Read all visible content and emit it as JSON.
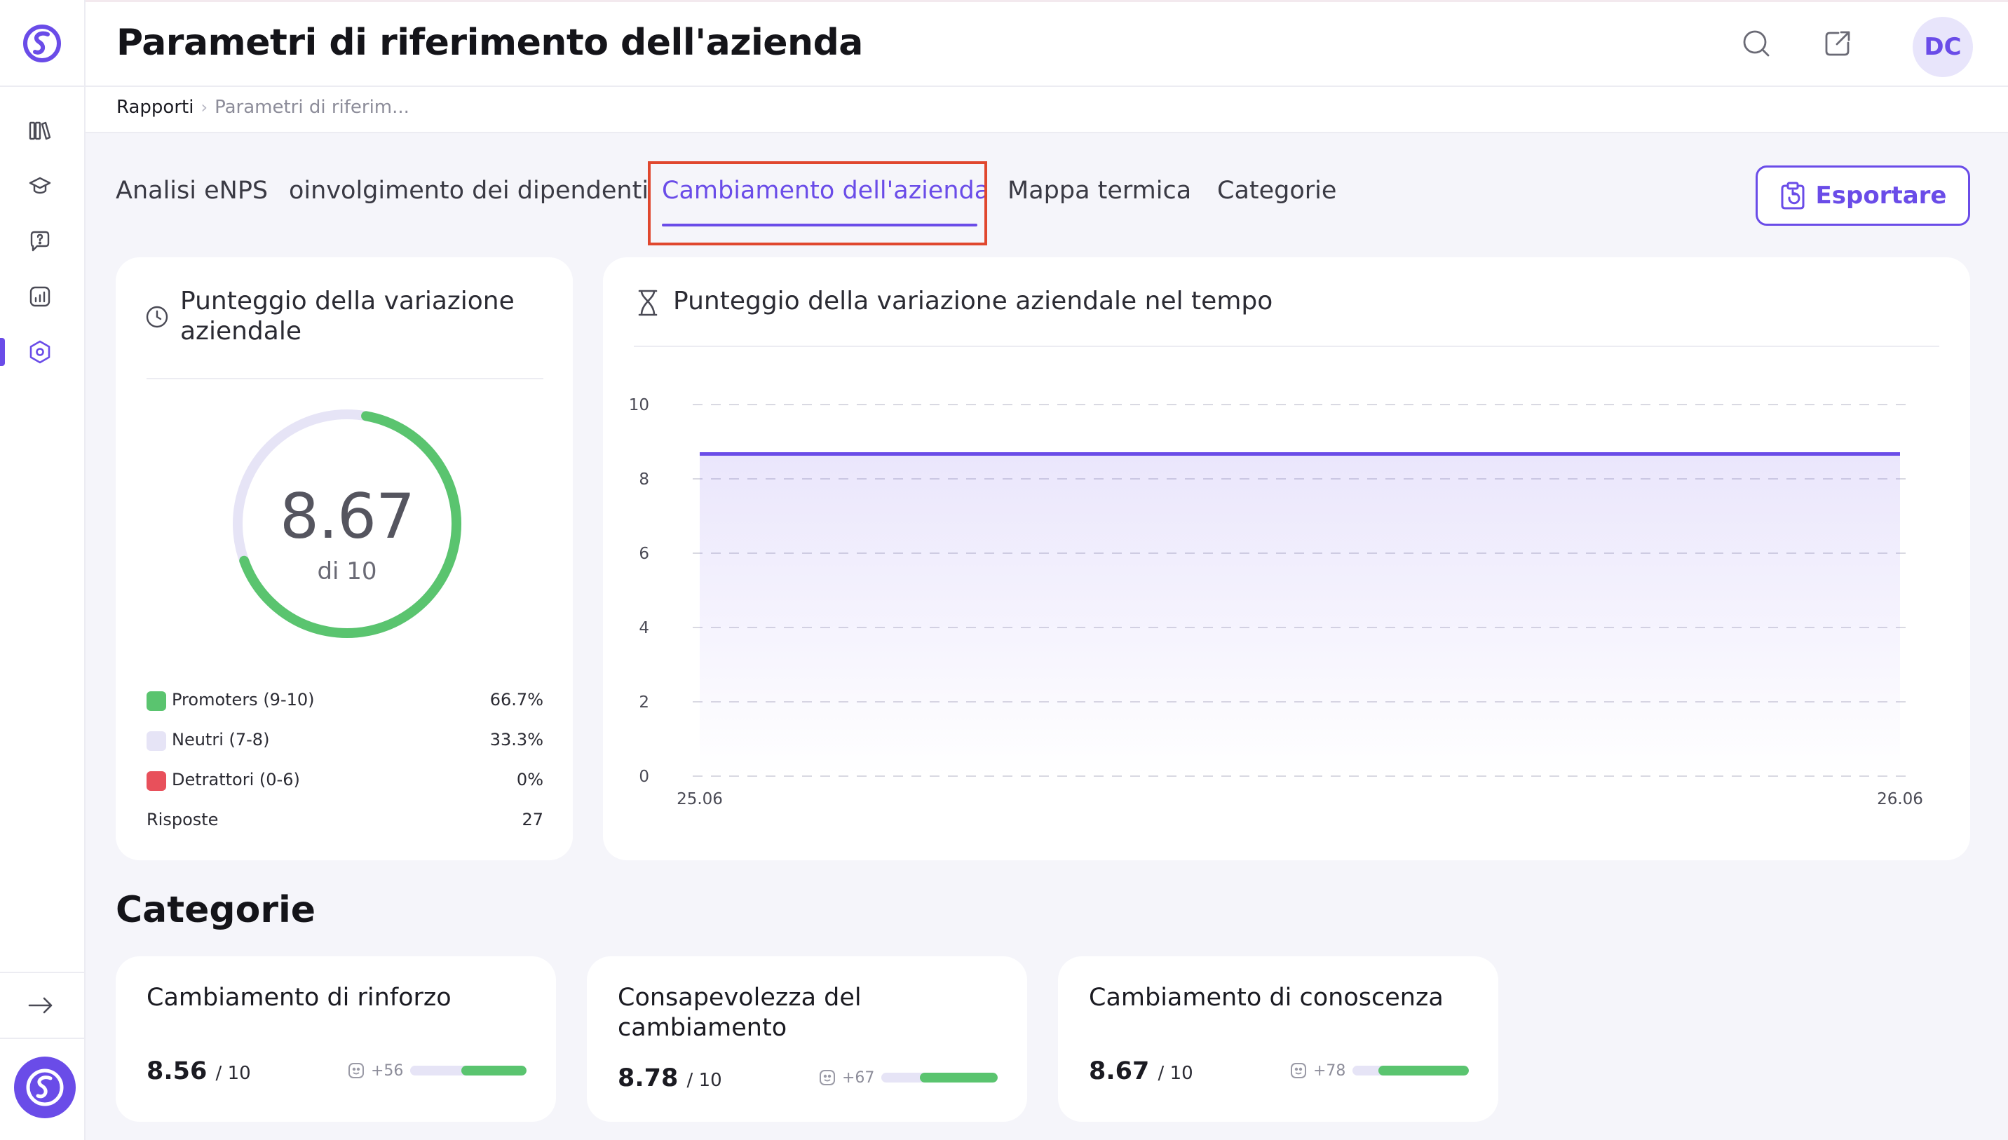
{
  "app": {
    "title": "Parametri di riferimento dell'azienda",
    "accent": "#6a4ce8"
  },
  "sidebar": {
    "items": [
      {
        "icon": "library-icon"
      },
      {
        "icon": "graduation-cap-icon"
      },
      {
        "icon": "help-chat-icon"
      },
      {
        "icon": "analytics-icon"
      },
      {
        "icon": "settings-hexagon-icon",
        "active": true
      }
    ],
    "expand_icon": "arrow-right-icon"
  },
  "header": {
    "avatar_initials": "DC"
  },
  "breadcrumb": {
    "root": "Rapporti",
    "current": "Parametri di riferim..."
  },
  "tabs": [
    {
      "label": "Analisi eNPS"
    },
    {
      "label": "oinvolgimento dei dipendenti"
    },
    {
      "label": "Cambiamento dell'azienda",
      "active": true
    },
    {
      "label": "Mappa termica"
    },
    {
      "label": "Categorie"
    }
  ],
  "export_button": {
    "label": "Esportare"
  },
  "score_card": {
    "title": "Punteggio della variazione aziendale",
    "value": "8.67",
    "of_label": "di 10",
    "gauge_fraction": 0.667,
    "legend": [
      {
        "label": "Promoters (9-10)",
        "value": "66.7%",
        "color": "#5ac46f"
      },
      {
        "label": "Neutri (7-8)",
        "value": "33.3%",
        "color": "#e6e4f6"
      },
      {
        "label": "Detrattori (0-6)",
        "value": "0%",
        "color": "#e8505b"
      },
      {
        "label": "Risposte",
        "value": "27"
      }
    ]
  },
  "chart_card": {
    "title": "Punteggio della variazione aziendale nel tempo"
  },
  "chart_data": {
    "type": "area",
    "x": [
      "25.06",
      "26.06"
    ],
    "series": [
      {
        "values": [
          8.67,
          8.67
        ],
        "color": "#6a4ce8"
      }
    ],
    "ylim": [
      0,
      10
    ],
    "yticks": [
      "0",
      "2",
      "4",
      "6",
      "8",
      "10"
    ],
    "grid": true,
    "title": "",
    "xlabel": "",
    "ylabel": ""
  },
  "categories_section": {
    "title": "Categorie",
    "cards": [
      {
        "title": "Cambiamento di rinforzo",
        "score": "8.56",
        "of": "/ 10",
        "delta": "+56",
        "bar_fraction": 0.56
      },
      {
        "title": "Consapevolezza del cambiamento",
        "score": "8.78",
        "of": "/ 10",
        "delta": "+67",
        "bar_fraction": 0.67
      },
      {
        "title": "Cambiamento di conoscenza",
        "score": "8.67",
        "of": "/ 10",
        "delta": "+78",
        "bar_fraction": 0.78
      }
    ]
  }
}
